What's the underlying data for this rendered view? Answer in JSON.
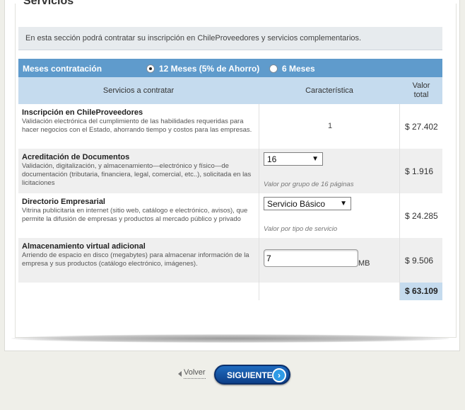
{
  "page": {
    "title": "Servicios"
  },
  "info": {
    "text": "En esta sección podrá contratar su inscripción en ChileProveedores y servicios complementarios."
  },
  "months": {
    "title": "Meses contratación",
    "options": [
      {
        "label": "12 Meses (5% de Ahorro)",
        "selected": true
      },
      {
        "label": "6 Meses",
        "selected": false
      }
    ]
  },
  "table": {
    "headers": {
      "services": "Servicios a contratar",
      "feature": "Característica",
      "value_line1": "Valor",
      "value_line2": "total"
    },
    "rows": [
      {
        "name": "Inscripción en ChileProveedores",
        "desc": "Validación electrónica del cumplimiento de las habilidades requeridas para hacer negocios con el Estado, ahorrando tiempo y costos para las empresas.",
        "feature": "1",
        "value": "$ 27.402"
      },
      {
        "name": "Acreditación de Documentos",
        "desc": "Validación, digitalización, y almacenamiento—electrónico y físico—de documentación (tributaria, financiera, legal, comercial, etc..), solicitada en las licitaciones",
        "select_value": "16",
        "hint": "Valor por grupo de 16 páginas",
        "value": "$ 1.916"
      },
      {
        "name": "Directorio Empresarial",
        "desc": "Vitrina publicitaria en internet (sitio web, catálogo e electrónico, avisos), que permite la difusión de empresas y productos al mercado público y privado",
        "select_value": "Servicio Básico",
        "hint": "Valor por tipo de servicio",
        "value": "$ 24.285"
      },
      {
        "name": "Almacenamiento virtual adicional",
        "desc": "Arriendo de espacio en disco (megabytes) para almacenar información de la empresa y sus productos (catálogo electrónico, imágenes).",
        "input_value": "7",
        "unit": "MB",
        "value": "$ 9.506"
      }
    ],
    "total": "$ 63.109"
  },
  "nav": {
    "back": "Volver",
    "next": "SIGUIENTE"
  },
  "colors": {
    "header_blue": "#5f9bcc",
    "light_blue": "#c5dbee",
    "button_blue": "#0d3f88"
  }
}
